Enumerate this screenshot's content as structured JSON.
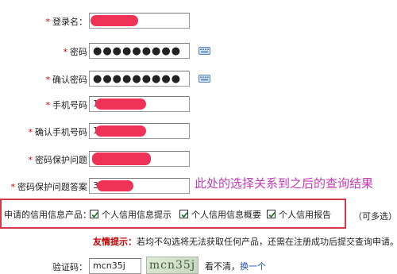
{
  "form": {
    "login_label": "登录名：",
    "password_label": "密码",
    "password_value": "●●●●●●●●●",
    "confirm_password_label": "确认密码",
    "confirm_password_value": "●●●●●●●●●",
    "phone_label": "手机号码",
    "phone_value": "1",
    "confirm_phone_label": "确认手机号码",
    "confirm_phone_value": "1",
    "security_question_label": "密码保护问题",
    "security_answer_label": "密码保护问题答案",
    "security_answer_value": "3",
    "required_mark": "*"
  },
  "annotation": "此处的选择关系到之后的查询结果",
  "credit_products": {
    "label": "申请的信用信息产品：",
    "options": [
      {
        "label": "个人信用信息提示",
        "checked": true
      },
      {
        "label": "个人信用信息概要",
        "checked": true
      },
      {
        "label": "个人信用报告",
        "checked": true
      }
    ],
    "multi_hint": "（可多选）"
  },
  "tip": {
    "title": "友情提示：",
    "text": "若均不勾选将无法获取任何产品，还需在注册成功后提交查询申请。"
  },
  "captcha": {
    "label": "验证码：",
    "value": "mcn35j",
    "image_text": "mcn35j",
    "unclear": "看不清，",
    "refresh": "换一个"
  },
  "colors": {
    "redaction": "#ee3356",
    "annotation": "#c23bb5",
    "highlight_box": "#d23b49",
    "tip_title": "#c00000"
  },
  "icons": {
    "keyboard": "soft-keyboard-icon",
    "check": "check-icon"
  }
}
